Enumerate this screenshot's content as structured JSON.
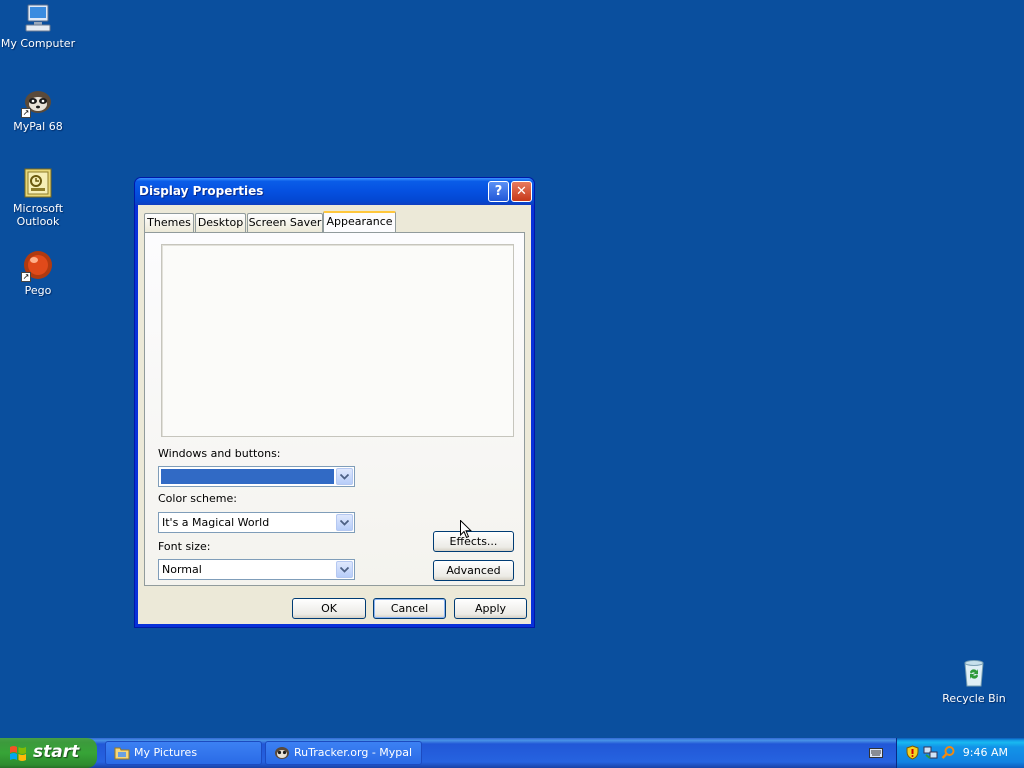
{
  "desktop": {
    "icons": [
      {
        "label": "My Computer",
        "icon": "my-computer-icon"
      },
      {
        "label": "MyPal 68",
        "icon": "mypal-icon"
      },
      {
        "label": "Microsoft Outlook",
        "icon": "outlook-icon"
      },
      {
        "label": "Pego",
        "icon": "pego-icon"
      },
      {
        "label": "Recycle Bin",
        "icon": "recycle-bin-icon"
      }
    ],
    "background_color": "#0a4f9e"
  },
  "dialog": {
    "title": "Display Properties",
    "help_glyph": "?",
    "close_glyph": "✕",
    "tabs": [
      {
        "label": "Themes"
      },
      {
        "label": "Desktop"
      },
      {
        "label": "Screen Saver"
      },
      {
        "label": "Appearance",
        "active": true
      }
    ],
    "windows_buttons": {
      "label": "Windows and buttons:",
      "value": ""
    },
    "color_scheme": {
      "label": "Color scheme:",
      "value": "It's a Magical World"
    },
    "font_size": {
      "label": "Font size:",
      "value": "Normal"
    },
    "effects_label": "Effects...",
    "advanced_label": "Advanced",
    "ok_label": "OK",
    "cancel_label": "Cancel",
    "apply_label": "Apply"
  },
  "taskbar": {
    "start_label": "start",
    "items": [
      {
        "label": "My Pictures",
        "icon": "folder-icon"
      },
      {
        "label": "RuTracker.org - Mypal",
        "icon": "mypal-icon"
      }
    ],
    "clock": "9:46 AM",
    "tray_icons": [
      "security-shield-icon",
      "network-icon",
      "search-icon"
    ]
  }
}
